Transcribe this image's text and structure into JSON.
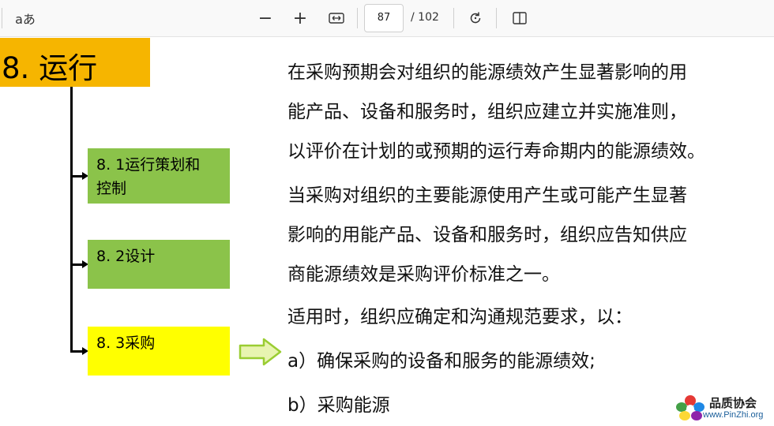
{
  "toolbar": {
    "read_aloud_label": "aあ",
    "zoom_out_label": "−",
    "zoom_in_label": "+",
    "current_page": "87",
    "page_total": "/ 102"
  },
  "slide": {
    "title": "8. 运行",
    "boxes": [
      {
        "line1": "8. 1运行策划和",
        "line2": "控制",
        "color": "#8bc34a"
      },
      {
        "line1": "8. 2设计",
        "line2": "",
        "color": "#8bc34a"
      },
      {
        "line1": "8. 3采购",
        "line2": "",
        "color": "#ffff00"
      }
    ],
    "paragraph_lines": [
      "在采购预期会对组织的能源绩效产生显著影响的用",
      "能产品、设备和服务时，组织应建立并实施准则，",
      "以评价在计划的或预期的运行寿命期内的能源绩效。",
      "当采购对组织的主要能源使用产生或可能产生显著",
      "影响的用能产品、设备和服务时，组织应告知供应",
      "商能源绩效是采购评价标准之一。",
      "适用时，组织应确定和沟通规范要求，以：",
      "a）确保采购的设备和服务的能源绩效;",
      "b）采购能源"
    ]
  },
  "logo": {
    "name": "品质协会",
    "url": "www.PinZhi.org"
  }
}
